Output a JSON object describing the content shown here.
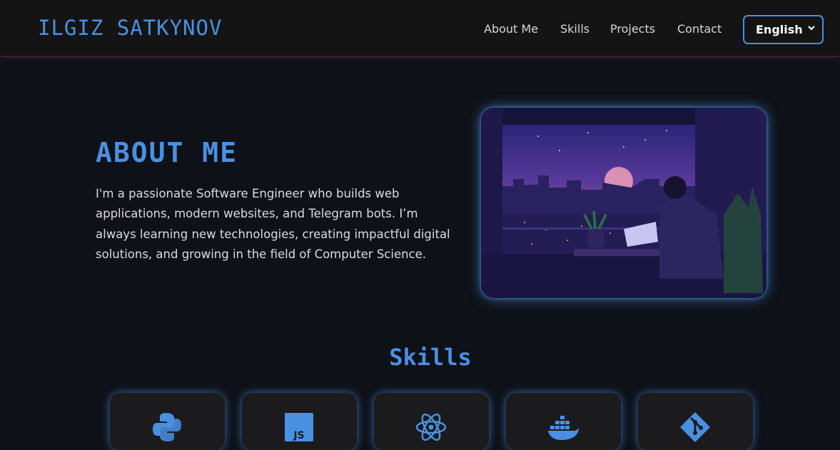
{
  "header": {
    "brand": "ILGIZ SATKYNOV",
    "nav": [
      "About Me",
      "Skills",
      "Projects",
      "Contact"
    ],
    "language": "English"
  },
  "about": {
    "title": "ABOUT ME",
    "text": "I'm a passionate Software Engineer who builds web applications, modern websites, and Telegram bots. I’m always learning new technologies, creating impactful digital solutions, and growing in the field of Computer Science."
  },
  "skills": {
    "title": "Skills",
    "items": [
      {
        "icon": "python-icon"
      },
      {
        "icon": "javascript-icon"
      },
      {
        "icon": "react-icon"
      },
      {
        "icon": "docker-icon"
      },
      {
        "icon": "git-icon"
      }
    ]
  },
  "colors": {
    "accent": "#4a90e2",
    "background": "#0e1117",
    "navbar": "#141414",
    "card": "#1b1b1d"
  }
}
